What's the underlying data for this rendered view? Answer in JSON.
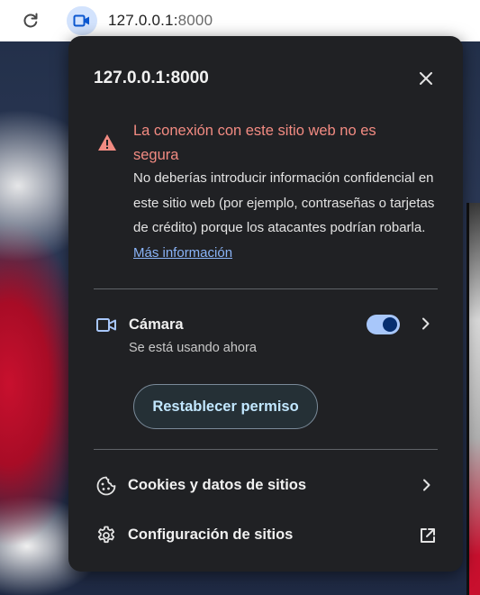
{
  "toolbar": {
    "reload_icon": "reload-icon",
    "site_chip_icon": "camera-icon",
    "url_host": "127.0.0.1:",
    "url_port": "8000"
  },
  "popup": {
    "title": "127.0.0.1:8000",
    "close_icon": "close-icon",
    "warning": {
      "icon": "warning-icon",
      "title": "La conexión con este sitio web no es segura",
      "description": "No deberías introducir información confidencial en este sitio web (por ejemplo, contraseñas o tarjetas de crédito) porque los atacantes podrían robarla. ",
      "link": "Más información",
      "color": "#f28b82"
    },
    "camera": {
      "icon": "camera-icon",
      "label": "Cámara",
      "status": "Se está usando ahora",
      "enabled": true
    },
    "reset_button": "Restablecer permiso",
    "cookies": {
      "icon": "cookie-icon",
      "label": "Cookies y datos de sitios"
    },
    "site_settings": {
      "icon": "gear-icon",
      "label": "Configuración de sitios",
      "trailing_icon": "open-external-icon"
    }
  },
  "colors": {
    "popup_bg": "#202124",
    "accent": "#a8c7fa",
    "link": "#8ab4f8"
  }
}
